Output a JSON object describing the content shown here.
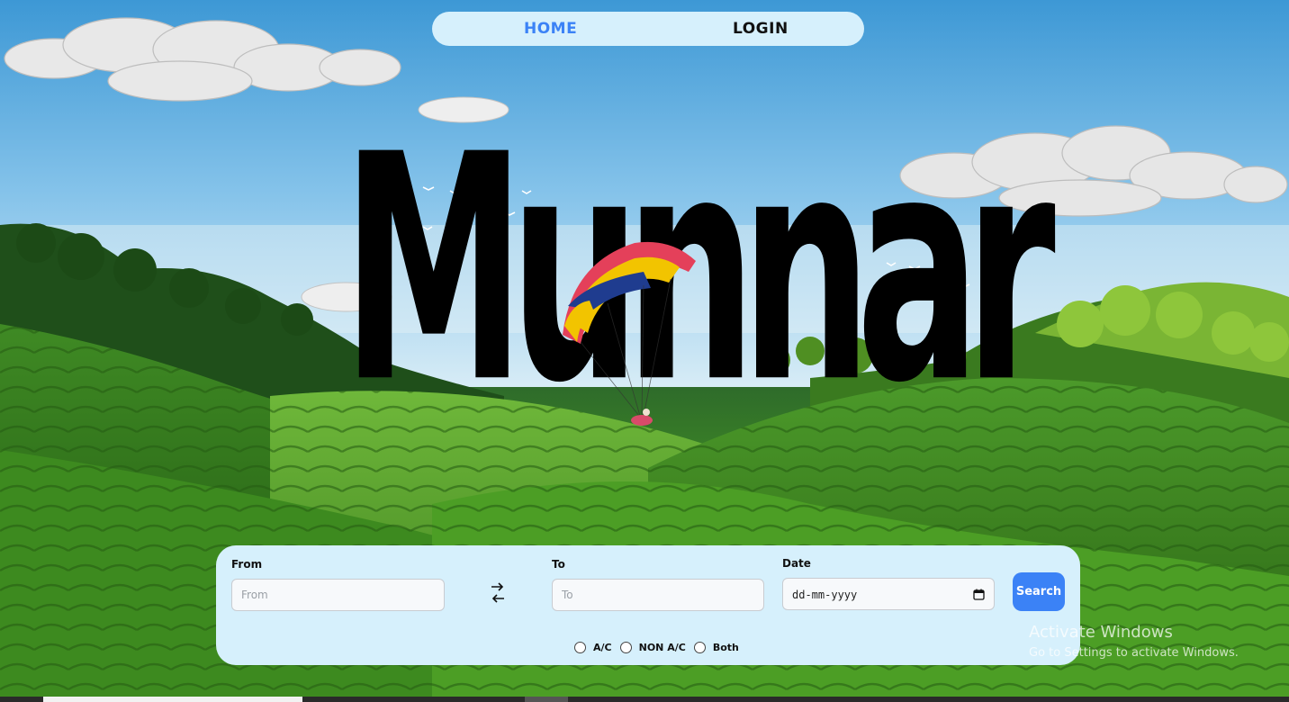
{
  "nav": {
    "home_label": "HOME",
    "login_label": "LOGIN"
  },
  "hero": {
    "title": "Munnar"
  },
  "search": {
    "from_label": "From",
    "from_placeholder": "From",
    "to_label": "To",
    "to_placeholder": "To",
    "date_label": "Date",
    "date_value": "dd-mm-yyyy",
    "search_label": "Search",
    "options": [
      "A/C",
      "NON A/C",
      "Both"
    ]
  },
  "watermark": {
    "title": "Activate Windows",
    "subtitle": "Go to Settings to activate Windows."
  },
  "colors": {
    "accent": "#3b82f6",
    "panel": "#d6f0fc"
  }
}
